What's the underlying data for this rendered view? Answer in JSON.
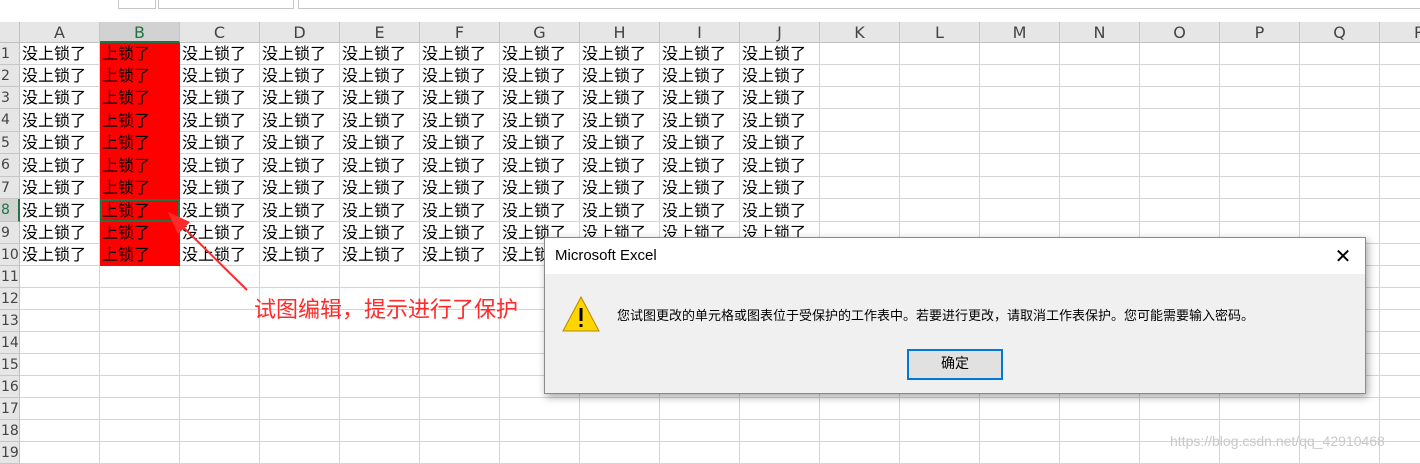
{
  "sheet": {
    "columns": [
      "A",
      "B",
      "C",
      "D",
      "E",
      "F",
      "G",
      "H",
      "I",
      "J",
      "K",
      "L",
      "M",
      "N",
      "O",
      "P",
      "Q",
      "R"
    ],
    "rows": [
      "1",
      "2",
      "3",
      "4",
      "5",
      "6",
      "7",
      "8",
      "9",
      "10",
      "11",
      "12",
      "13",
      "14",
      "15",
      "16",
      "17",
      "18",
      "19"
    ],
    "cell_text_unlocked": "没上锁了",
    "cell_text_locked": "上锁了",
    "selected_cell": "B8",
    "locked_fill_color": "#ff0000",
    "header_selected_color": "#217346"
  },
  "annotation": {
    "text": "试图编辑，提示进行了保护",
    "color": "#ff2a2a"
  },
  "dialog": {
    "title": "Microsoft Excel",
    "close_icon": "close-icon",
    "warning_icon": "warning-icon",
    "message": "您试图更改的单元格或图表位于受保护的工作表中。若要进行更改，请取消工作表保护。您可能需要输入密码。",
    "ok_label": "确定"
  },
  "watermark": "https://blog.csdn.net/qq_42910468"
}
